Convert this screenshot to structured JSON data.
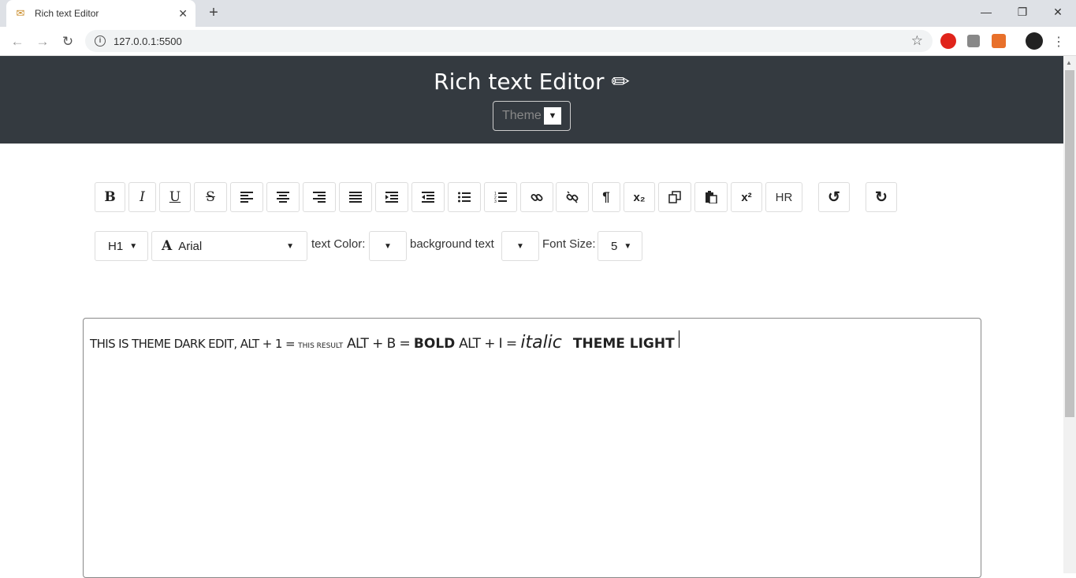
{
  "browser": {
    "tab_title": "Rich text Editor",
    "tab_close": "✕",
    "new_tab": "+",
    "url": "127.0.0.1:5500"
  },
  "app": {
    "title": "Rich text Editor",
    "theme_select_label": "Theme",
    "header_bg": "#343a40"
  },
  "toolbar": {
    "bold": "B",
    "italic": "I",
    "underline": "U",
    "strike": "S",
    "subscript": "x₂",
    "superscript": "x²",
    "hr": "HR"
  },
  "format_row": {
    "heading_value": "H1",
    "font_value": "Arial",
    "text_color_label": "text Color:",
    "background_label": "background text",
    "font_size_label": "Font Size:",
    "font_size_value": "5"
  },
  "editor": {
    "seg1": "THIS IS THEME DARK EDIT, ALT + 1 = ",
    "seg2": "THIS RESULT",
    "seg3": " ALT + B = ",
    "seg4": "BOLD",
    "seg5": " ALT + I = ",
    "seg6": "italic",
    "seg7": "THEME LIGHT"
  }
}
